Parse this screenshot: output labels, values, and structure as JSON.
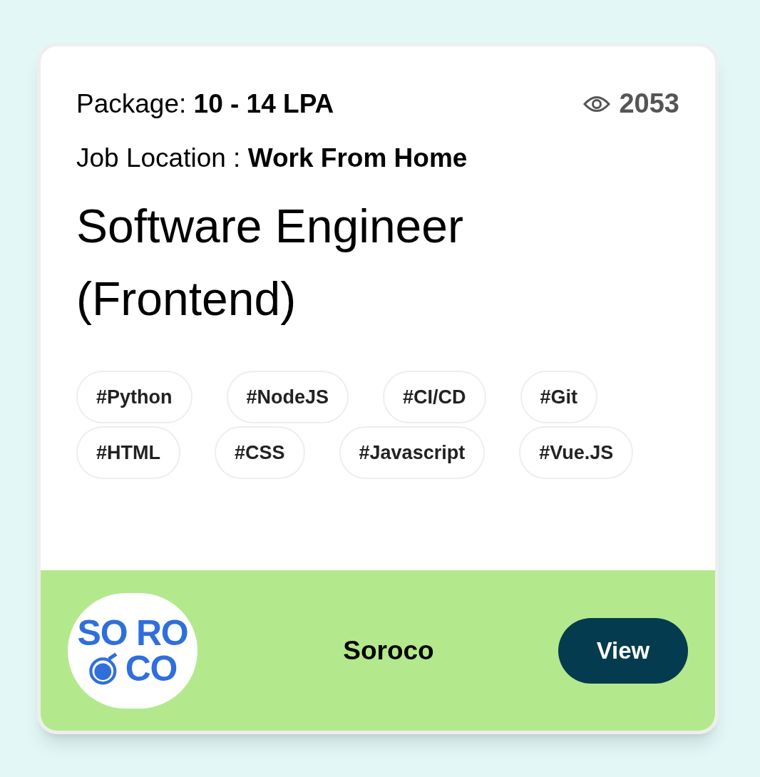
{
  "package": {
    "label": "Package:",
    "value": "10 - 14 LPA"
  },
  "views": "2053",
  "location": {
    "label": "Job Location :",
    "value": "Work From Home"
  },
  "title": "Software Engineer (Frontend)",
  "tags": [
    "#Python",
    "#NodeJS",
    "#CI/CD",
    "#Git",
    "#HTML",
    "#CSS",
    "#Javascript",
    "#Vue.JS"
  ],
  "company": {
    "logo_lines": [
      "SO RO",
      "CO"
    ],
    "name": "Soroco"
  },
  "button": "View"
}
